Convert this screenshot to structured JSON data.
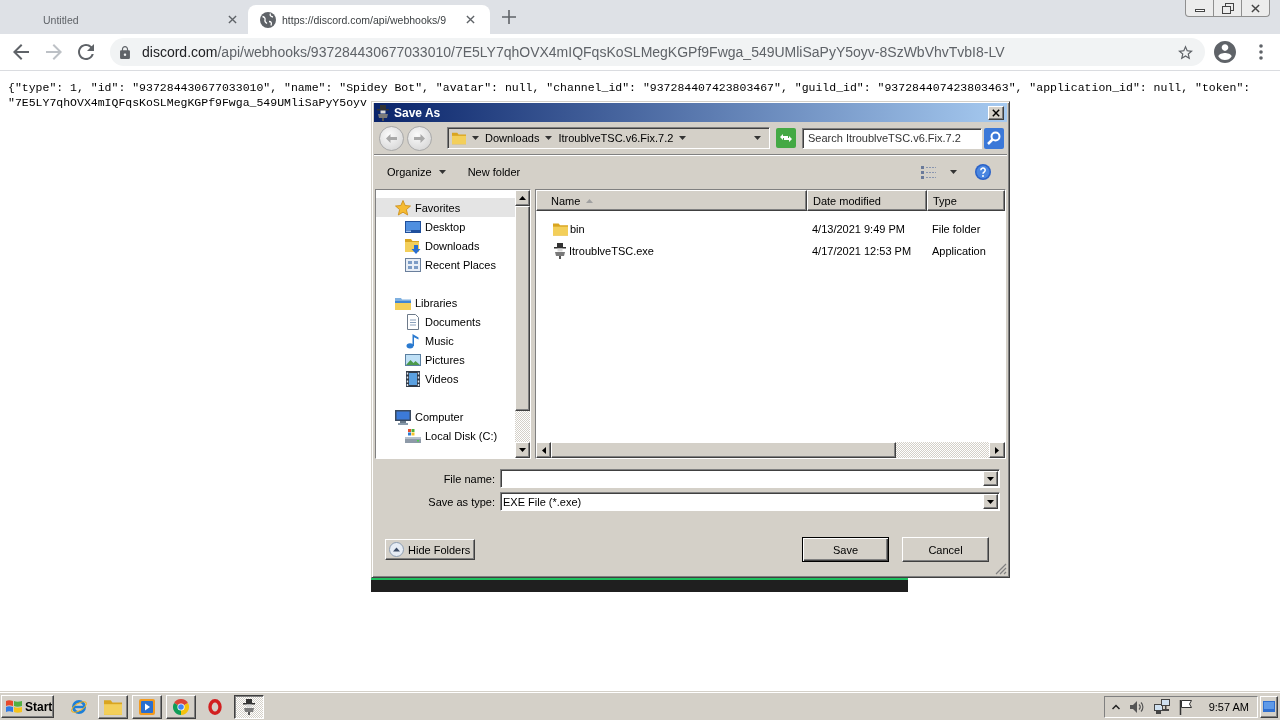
{
  "browser": {
    "tabs": [
      {
        "title": "Untitled",
        "selected": false,
        "favicon": false
      },
      {
        "title": "https://discord.com/api/webhooks/9",
        "selected": true,
        "favicon": true
      }
    ],
    "nav_buttons": [
      {
        "kind": "back",
        "disabled": false
      },
      {
        "kind": "forward",
        "disabled": true
      },
      {
        "kind": "reload",
        "disabled": false
      }
    ],
    "address": {
      "host": "discord.com",
      "path": "/api/webhooks/937284430677033010/7E5LY7qhOVX4mIQFqsKoSLMegKGPf9Fwga_549UMliSaPyY5oyv-8SzWbVhvTvbI8-LV"
    }
  },
  "page": {
    "lines": [
      "{\"type\": 1, \"id\": \"937284430677033010\", \"name\": \"Spidey Bot\", \"avatar\": null, \"channel_id\": \"937284407423803467\", \"guild_id\": \"937284407423803463\", \"application_id\": null, \"token\":",
      "\"7E5LY7qhOVX4mIQFqsKoSLMegKGPf9Fwga_549UMliSaPyY5oyv"
    ]
  },
  "dialog": {
    "title": "Save As",
    "nav_buttons": [
      {
        "kind": "back",
        "disabled": true
      },
      {
        "kind": "forward",
        "disabled": true
      }
    ],
    "breadcrumb": [
      "Downloads",
      "ItroublveTSC.v6.Fix.7.2"
    ],
    "search": {
      "placeholder": "Search ItroublveTSC.v6.Fix.7.2"
    },
    "commands": [
      {
        "label": "Organize",
        "menu": true
      },
      {
        "label": "New folder",
        "menu": false
      }
    ],
    "nav_tree": [
      {
        "label": "Favorites",
        "kind": "favorites",
        "selected": true,
        "children": [
          {
            "label": "Desktop",
            "kind": "desktop",
            "selected": false
          },
          {
            "label": "Downloads",
            "kind": "downloads",
            "selected": false
          },
          {
            "label": "Recent Places",
            "kind": "recent",
            "selected": false
          }
        ]
      },
      {
        "label": "Libraries",
        "kind": "libraries",
        "selected": false,
        "children": [
          {
            "label": "Documents",
            "kind": "documents",
            "selected": false
          },
          {
            "label": "Music",
            "kind": "music",
            "selected": false
          },
          {
            "label": "Pictures",
            "kind": "pictures",
            "selected": false
          },
          {
            "label": "Videos",
            "kind": "videos",
            "selected": false
          }
        ]
      },
      {
        "label": "Computer",
        "kind": "computer",
        "selected": false,
        "children": [
          {
            "label": "Local Disk (C:)",
            "kind": "disk",
            "selected": false
          }
        ]
      }
    ],
    "columns": [
      {
        "label": "Name",
        "sorted": true
      },
      {
        "label": "Date modified",
        "sorted": false
      },
      {
        "label": "Type",
        "sorted": false
      }
    ],
    "files": [
      {
        "name": "bin",
        "kind": "folder",
        "date": "4/13/2021 9:49 PM",
        "type": "File folder",
        "selected": false
      },
      {
        "name": "ItroublveTSC.exe",
        "kind": "application",
        "date": "4/17/2021 12:53 PM",
        "type": "Application",
        "selected": false
      }
    ],
    "fields": [
      {
        "label": "File name:"
      },
      {
        "label": "Save as type:",
        "value": "EXE File (*.exe)"
      }
    ],
    "hide_folders": "Hide Folders",
    "buttons": [
      {
        "label": "Save",
        "default": true
      },
      {
        "label": "Cancel",
        "default": false
      }
    ]
  },
  "taskbar": {
    "start": "Start",
    "apps": [
      {
        "kind": "browser",
        "running": false,
        "selected": false
      },
      {
        "kind": "folder",
        "running": true,
        "selected": false
      },
      {
        "kind": "media",
        "running": true,
        "selected": false
      },
      {
        "kind": "round",
        "running": true,
        "selected": false
      },
      {
        "kind": "ring",
        "running": false,
        "selected": false
      },
      {
        "kind": "figure",
        "running": true,
        "selected": true
      }
    ],
    "clock": "9:57 AM"
  }
}
